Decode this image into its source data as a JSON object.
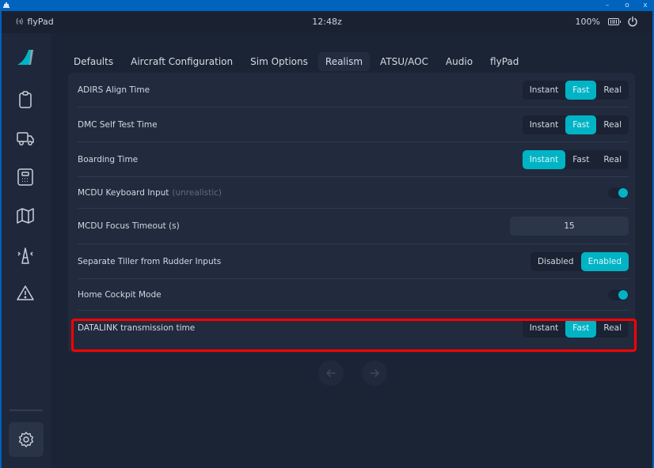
{
  "window": {
    "minimize_label": "–",
    "maximize_label": "o",
    "close_label": "x"
  },
  "statusbar": {
    "app_name": "flyPad",
    "wifi_glyph": "(·ı)",
    "time": "12:48z",
    "battery_percent": "100%"
  },
  "sidebar": {
    "items": [
      {
        "name": "logo",
        "icon": "tail-logo-icon"
      },
      {
        "name": "dispatch",
        "icon": "clipboard-icon"
      },
      {
        "name": "ground",
        "icon": "truck-icon"
      },
      {
        "name": "performance",
        "icon": "calculator-icon"
      },
      {
        "name": "navigation",
        "icon": "map-icon"
      },
      {
        "name": "atc",
        "icon": "radio-tower-icon"
      },
      {
        "name": "failures",
        "icon": "warning-icon"
      }
    ],
    "settings_icon": "gear-icon"
  },
  "tabs": [
    {
      "label": "Defaults",
      "active": false
    },
    {
      "label": "Aircraft Configuration",
      "active": false
    },
    {
      "label": "Sim Options",
      "active": false
    },
    {
      "label": "Realism",
      "active": true
    },
    {
      "label": "ATSU/AOC",
      "active": false
    },
    {
      "label": "Audio",
      "active": false
    },
    {
      "label": "flyPad",
      "active": false
    }
  ],
  "settings": {
    "adirs": {
      "label": "ADIRS Align Time",
      "options": [
        "Instant",
        "Fast",
        "Real"
      ],
      "selected": "Fast"
    },
    "dmc": {
      "label": "DMC Self Test Time",
      "options": [
        "Instant",
        "Fast",
        "Real"
      ],
      "selected": "Fast"
    },
    "boarding": {
      "label": "Boarding Time",
      "options": [
        "Instant",
        "Fast",
        "Real"
      ],
      "selected": "Instant"
    },
    "mcdu_keyboard": {
      "label": "MCDU Keyboard Input",
      "hint": "(unrealistic)",
      "enabled": true
    },
    "mcdu_timeout": {
      "label": "MCDU Focus Timeout (s)",
      "value": "15"
    },
    "tiller": {
      "label": "Separate Tiller from Rudder Inputs",
      "options": [
        "Disabled",
        "Enabled"
      ],
      "selected": "Enabled"
    },
    "home_cockpit": {
      "label": "Home Cockpit Mode",
      "enabled": true
    },
    "datalink": {
      "label": "DATALINK transmission time",
      "options": [
        "Instant",
        "Fast",
        "Real"
      ],
      "selected": "Fast"
    }
  },
  "colors": {
    "accent": "#00b4c5",
    "highlight": "#ff0000",
    "titlebar": "#0063bd"
  }
}
